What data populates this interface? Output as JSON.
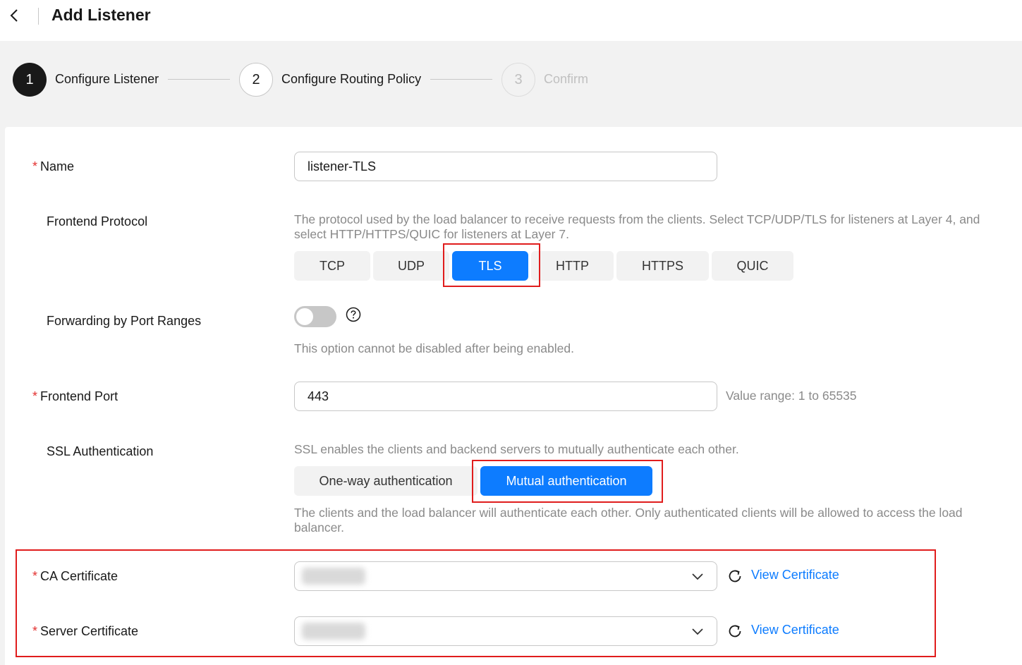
{
  "header": {
    "title": "Add Listener"
  },
  "steps": [
    {
      "number": "1",
      "label": "Configure Listener",
      "state": "active"
    },
    {
      "number": "2",
      "label": "Configure Routing Policy",
      "state": "pending"
    },
    {
      "number": "3",
      "label": "Confirm",
      "state": "disabled"
    }
  ],
  "form": {
    "name": {
      "label": "Name",
      "value": "listener-TLS"
    },
    "frontend_protocol": {
      "label": "Frontend Protocol",
      "hint": "The protocol used by the load balancer to receive requests from the clients. Select TCP/UDP/TLS for listeners at Layer 4, and select HTTP/HTTPS/QUIC for listeners at Layer 7.",
      "options": [
        "TCP",
        "UDP",
        "TLS",
        "HTTP",
        "HTTPS",
        "QUIC"
      ],
      "selected": "TLS"
    },
    "port_ranges": {
      "label": "Forwarding by Port Ranges",
      "enabled": false,
      "hint": "This option cannot be disabled after being enabled."
    },
    "frontend_port": {
      "label": "Frontend Port",
      "value": "443",
      "hint": "Value range: 1 to 65535"
    },
    "ssl_auth": {
      "label": "SSL Authentication",
      "hint": "SSL enables the clients and backend servers to mutually authenticate each other.",
      "options": [
        "One-way authentication",
        "Mutual authentication"
      ],
      "selected": "Mutual authentication",
      "description": "The clients and the load balancer will authenticate each other. Only authenticated clients will be allowed to access the load balancer."
    },
    "ca_certificate": {
      "label": "CA Certificate",
      "link": "View Certificate"
    },
    "server_certificate": {
      "label": "Server Certificate",
      "link": "View Certificate"
    }
  },
  "colors": {
    "accent": "#0d7cff",
    "required": "#e3302f",
    "highlight": "#e01d1d"
  }
}
